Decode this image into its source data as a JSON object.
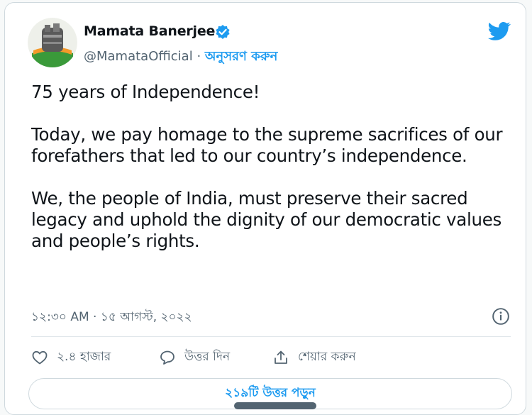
{
  "author": {
    "name": "Mamata Banerjee",
    "handle": "@MamataOfficial",
    "separator": "·",
    "follow_label": "অনুসরণ করুন"
  },
  "icons": {
    "verified": "verified-badge-icon",
    "brand": "twitter-bird-icon",
    "info": "info-icon",
    "like": "heart-icon",
    "reply": "reply-bubble-icon",
    "share": "share-icon"
  },
  "colors": {
    "accent": "#1d9bf0",
    "text": "#0f1419",
    "secondary": "#536471",
    "border": "#cfd9de"
  },
  "tweet": {
    "paragraphs": [
      "75 years of Independence!",
      "Today, we pay homage to the supreme sacrifices of our forefathers that led to our country’s independence.",
      "We, the people of India, must preserve their sacred legacy and uphold the dignity of our democratic values and people’s rights."
    ],
    "timestamp": "১২:৩০ AM · ১৫ আগস্ট, ২০২২"
  },
  "actions": {
    "likes_label": "২.৪ হাজার",
    "reply_label": "উত্তর দিন",
    "share_label": "শেয়ার করুন"
  },
  "replies": {
    "read_label": "২১৯টি উত্তর পড়ুন"
  }
}
